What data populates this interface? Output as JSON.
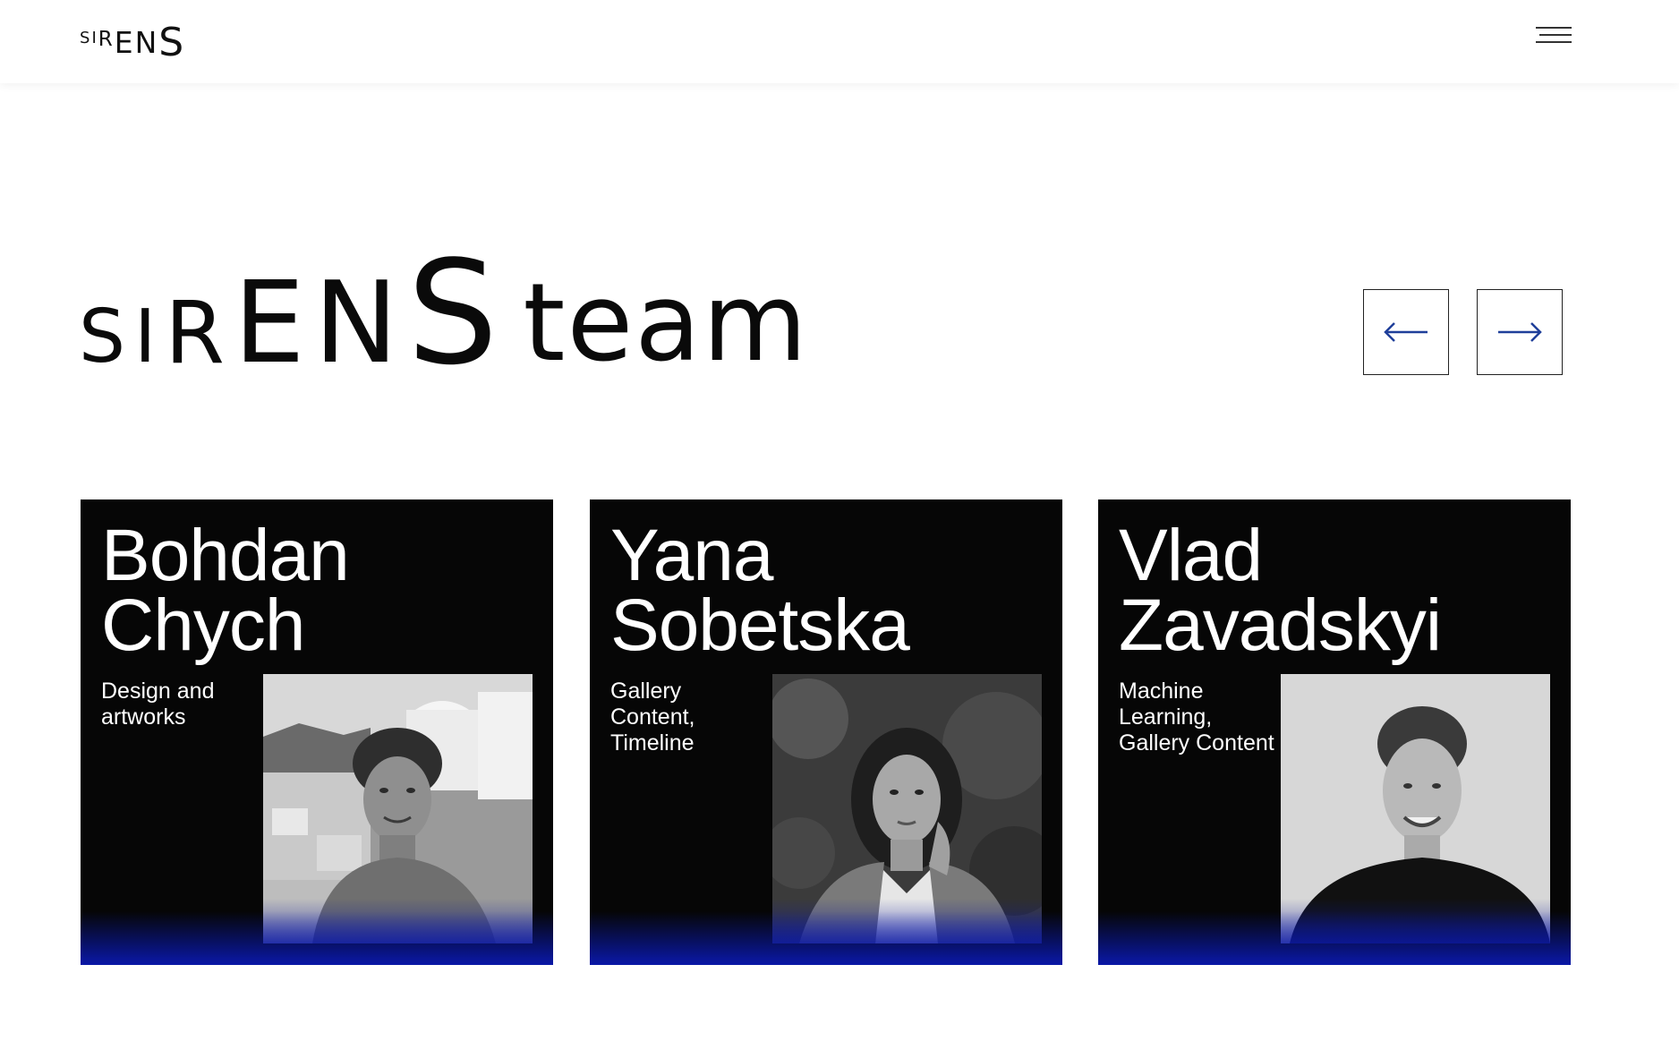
{
  "header": {
    "logo": [
      "S",
      "I",
      "R",
      "E",
      "N",
      "S"
    ],
    "menu_icon": "hamburger-menu-icon"
  },
  "hero": {
    "logo": [
      "S",
      "I",
      "R",
      "E",
      "N",
      "S"
    ],
    "title_suffix": "team"
  },
  "navigation": {
    "prev_icon": "arrow-left-icon",
    "next_icon": "arrow-right-icon",
    "arrow_color": "#1f3f9a"
  },
  "team": [
    {
      "name_line1": "Bohdan",
      "name_line2": "Chych",
      "role": "Design and artworks"
    },
    {
      "name_line1": "Yana",
      "name_line2": "Sobetska",
      "role": "Gallery Content, Timeline"
    },
    {
      "name_line1": "Vlad",
      "name_line2": "Zavadskyi",
      "role": "Machine Learning, Gallery Content"
    }
  ],
  "colors": {
    "card_background": "#060606",
    "card_gradient": "#0a18a8"
  }
}
